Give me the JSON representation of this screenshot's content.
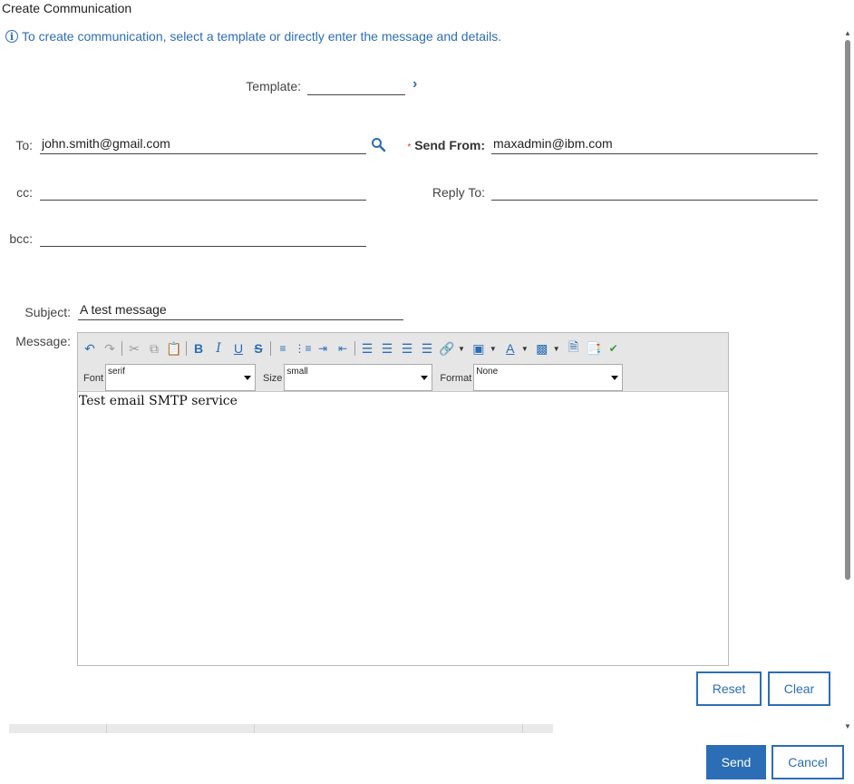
{
  "window": {
    "title": "Create Communication"
  },
  "info": {
    "text": "To create communication, select a template or directly enter the message and details."
  },
  "form": {
    "template": {
      "label": "Template:",
      "value": ""
    },
    "to": {
      "label": "To:",
      "value": "john.smith@gmail.com"
    },
    "send_from": {
      "label": "Send From:",
      "value": "maxadmin@ibm.com",
      "required_mark": "*"
    },
    "cc": {
      "label": "cc:",
      "value": ""
    },
    "reply_to": {
      "label": "Reply To:",
      "value": ""
    },
    "bcc": {
      "label": "bcc:",
      "value": ""
    },
    "subject": {
      "label": "Subject:",
      "value": "A test message"
    },
    "message": {
      "label": "Message:"
    }
  },
  "editor": {
    "font": {
      "label": "Font",
      "value": "serif"
    },
    "size": {
      "label": "Size",
      "value": "small"
    },
    "format": {
      "label": "Format",
      "value": "None"
    },
    "body": "Test email SMTP service",
    "toolbar_icons": [
      "undo-icon",
      "redo-icon",
      "cut-icon",
      "copy-icon",
      "paste-icon",
      "bold-icon",
      "italic-icon",
      "underline-icon",
      "strikethrough-icon",
      "ordered-list-icon",
      "unordered-list-icon",
      "indent-icon",
      "outdent-icon",
      "align-left-icon",
      "align-right-icon",
      "align-center-icon",
      "justify-icon",
      "link-icon",
      "image-icon",
      "text-color-icon",
      "highlight-color-icon",
      "insert-file-icon",
      "paste-word-icon",
      "spellcheck-icon"
    ]
  },
  "buttons": {
    "reset": "Reset",
    "clear": "Clear",
    "send": "Send",
    "cancel": "Cancel"
  },
  "colors": {
    "accent": "#2c6eb5",
    "required": "#c0392b"
  }
}
